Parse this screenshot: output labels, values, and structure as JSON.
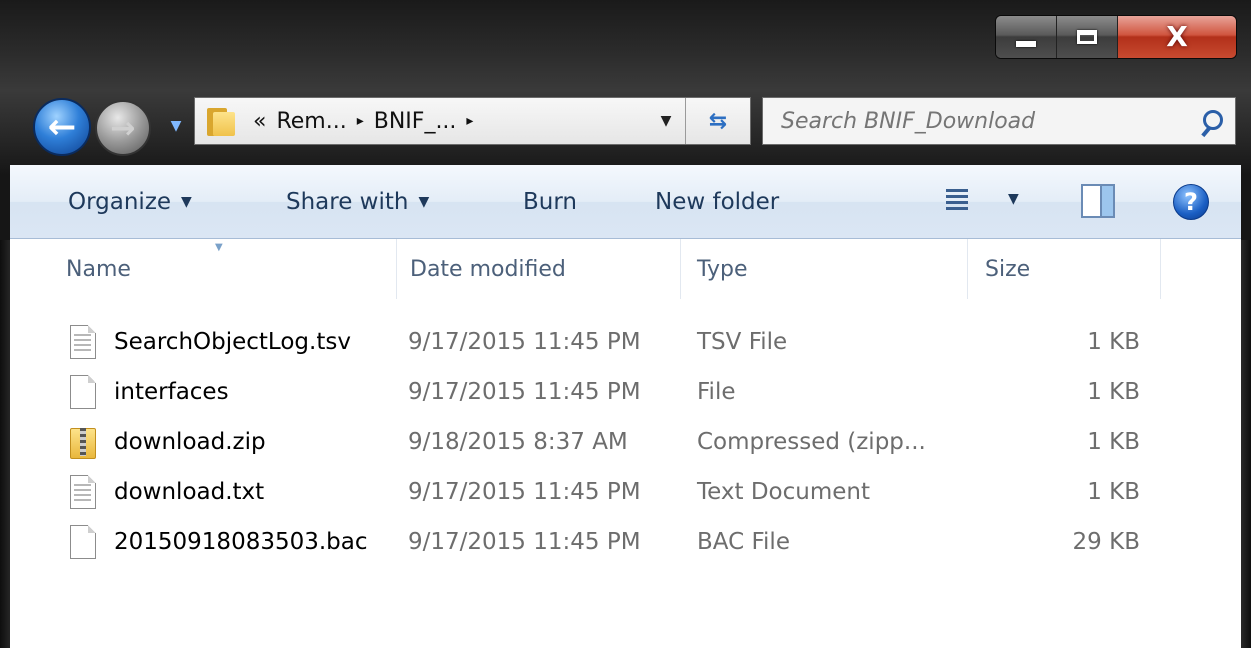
{
  "window": {
    "minimize_glyph": "",
    "maximize_glyph": "",
    "close_glyph": "X"
  },
  "navigation": {
    "back_glyph": "←",
    "forward_glyph": "→",
    "dropdown_glyph": "▼",
    "breadcrumb": {
      "overflow": "«",
      "segments": [
        "Rem...",
        "BNIF_..."
      ],
      "separator": "▸"
    },
    "address_dropdown_glyph": "▼",
    "refresh_glyph": "⇆"
  },
  "search": {
    "placeholder": "Search BNIF_Download"
  },
  "toolbar": {
    "organize_label": "Organize",
    "share_label": "Share with",
    "burn_label": "Burn",
    "new_folder_label": "New folder",
    "dropdown_glyph": "▼",
    "help_glyph": "?"
  },
  "columns": {
    "name": "Name",
    "date_modified": "Date modified",
    "type": "Type",
    "size": "Size"
  },
  "files": [
    {
      "name": "SearchObjectLog.tsv",
      "date": "9/17/2015 11:45 PM",
      "type": "TSV File",
      "size": "1 KB",
      "icon": "text-file-icon"
    },
    {
      "name": "interfaces",
      "date": "9/17/2015 11:45 PM",
      "type": "File",
      "size": "1 KB",
      "icon": "blank-file-icon"
    },
    {
      "name": "download.zip",
      "date": "9/18/2015 8:37 AM",
      "type": "Compressed (zipp...",
      "size": "1 KB",
      "icon": "zip-folder-icon"
    },
    {
      "name": "download.txt",
      "date": "9/17/2015 11:45 PM",
      "type": "Text Document",
      "size": "1 KB",
      "icon": "text-file-icon"
    },
    {
      "name": "20150918083503.bac",
      "date": "9/17/2015 11:45 PM",
      "type": "BAC File",
      "size": "29 KB",
      "icon": "blank-file-icon"
    }
  ],
  "colors": {
    "toolbar_text": "#1e395b",
    "header_text": "#4c607a",
    "meta_text": "#6d6d6d",
    "close_button": "#c84a30"
  }
}
